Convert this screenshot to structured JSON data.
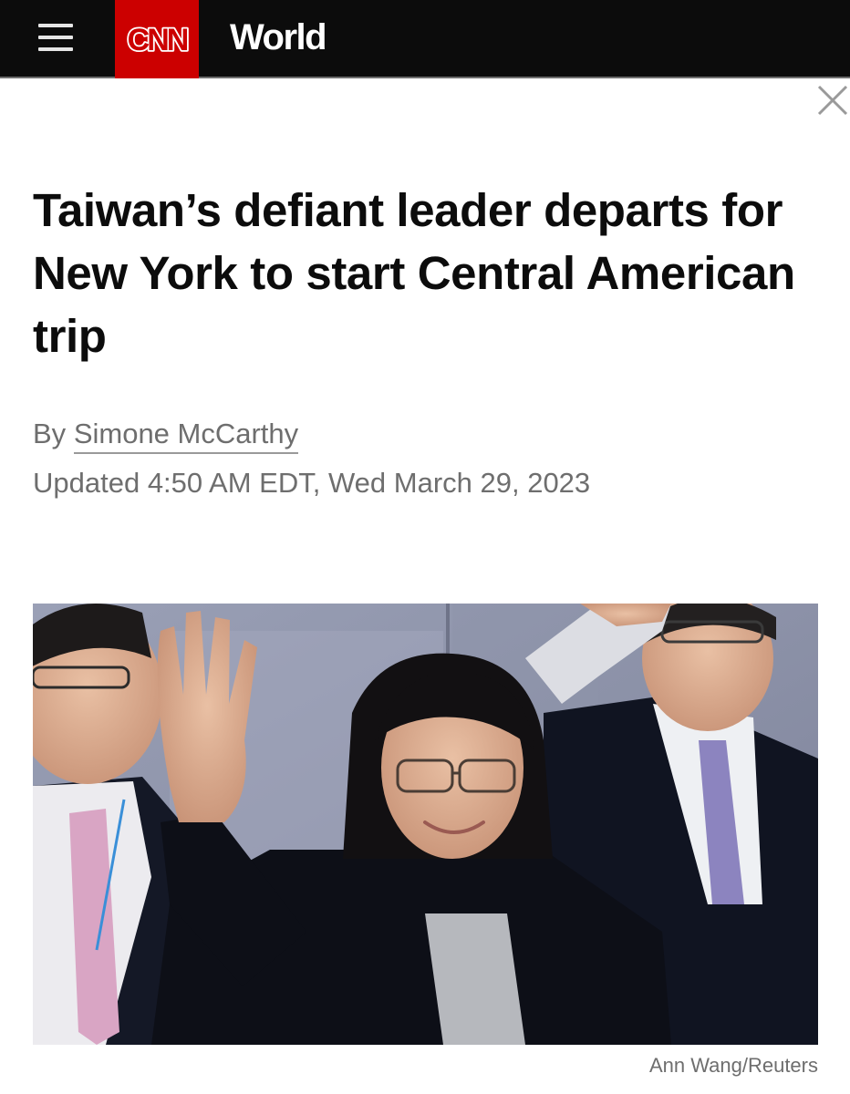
{
  "header": {
    "menu_icon": "hamburger-menu-icon",
    "logo_text": "CNN",
    "section": "World",
    "close_icon": "close-icon",
    "colors": {
      "bar": "#0c0c0c",
      "logo_bg": "#cc0000",
      "logo_fg": "#ffffff"
    }
  },
  "article": {
    "headline": "Taiwan’s defiant leader departs for New York to start Central American trip",
    "byline_prefix": "By",
    "author": "Simone McCarthy",
    "updated": "Updated 4:50 AM EDT, Wed March 29, 2023"
  },
  "image": {
    "credit": "Ann Wang/Reuters"
  }
}
